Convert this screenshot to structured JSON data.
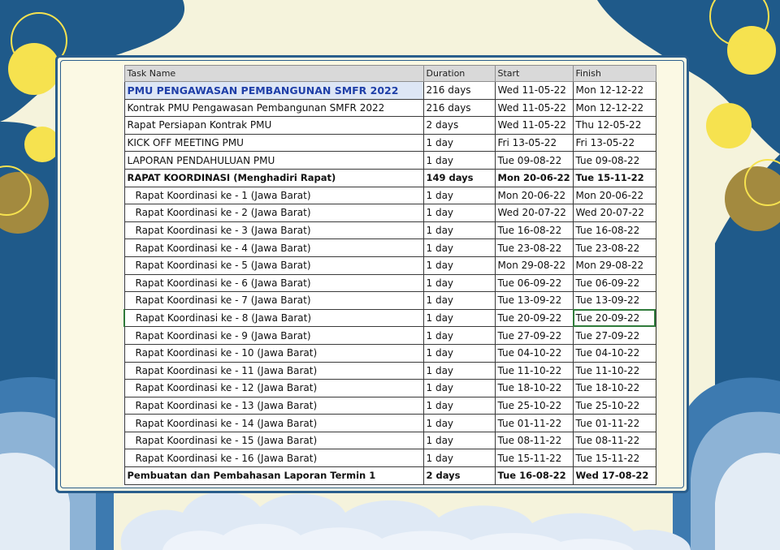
{
  "headers": {
    "task": "Task Name",
    "duration": "Duration",
    "start": "Start",
    "finish": "Finish"
  },
  "rows": [
    {
      "task": "PMU PENGAWASAN PEMBANGUNAN SMFR 2022",
      "duration": "216 days",
      "start": "Wed 11-05-22",
      "finish": "Mon 12-12-22"
    },
    {
      "task": "Kontrak PMU Pengawasan Pembangunan SMFR 2022",
      "duration": "216 days",
      "start": "Wed 11-05-22",
      "finish": "Mon 12-12-22"
    },
    {
      "task": "Rapat Persiapan Kontrak PMU",
      "duration": "2 days",
      "start": "Wed 11-05-22",
      "finish": "Thu 12-05-22"
    },
    {
      "task": "KICK OFF MEETING PMU",
      "duration": "1 day",
      "start": "Fri 13-05-22",
      "finish": "Fri 13-05-22"
    },
    {
      "task": "LAPORAN PENDAHULUAN PMU",
      "duration": "1 day",
      "start": "Tue 09-08-22",
      "finish": "Tue 09-08-22"
    },
    {
      "task": "RAPAT KOORDINASI (Menghadiri Rapat)",
      "duration": "149 days",
      "start": "Mon 20-06-22",
      "finish": "Tue 15-11-22"
    },
    {
      "task": "Rapat Koordinasi ke - 1 (Jawa Barat)",
      "duration": "1 day",
      "start": "Mon 20-06-22",
      "finish": "Mon 20-06-22"
    },
    {
      "task": "Rapat Koordinasi ke - 2 (Jawa Barat)",
      "duration": "1 day",
      "start": "Wed 20-07-22",
      "finish": "Wed 20-07-22"
    },
    {
      "task": "Rapat Koordinasi ke - 3 (Jawa Barat)",
      "duration": "1 day",
      "start": "Tue 16-08-22",
      "finish": "Tue 16-08-22"
    },
    {
      "task": "Rapat Koordinasi ke - 4 (Jawa Barat)",
      "duration": "1 day",
      "start": "Tue 23-08-22",
      "finish": "Tue 23-08-22"
    },
    {
      "task": "Rapat Koordinasi ke - 5 (Jawa Barat)",
      "duration": "1 day",
      "start": "Mon 29-08-22",
      "finish": "Mon 29-08-22"
    },
    {
      "task": "Rapat Koordinasi ke - 6 (Jawa Barat)",
      "duration": "1 day",
      "start": "Tue 06-09-22",
      "finish": "Tue 06-09-22"
    },
    {
      "task": "Rapat Koordinasi ke - 7 (Jawa Barat)",
      "duration": "1 day",
      "start": "Tue 13-09-22",
      "finish": "Tue 13-09-22"
    },
    {
      "task": "Rapat Koordinasi ke - 8 (Jawa Barat)",
      "duration": "1 day",
      "start": "Tue 20-09-22",
      "finish": "Tue 20-09-22"
    },
    {
      "task": "Rapat Koordinasi ke - 9 (Jawa Barat)",
      "duration": "1 day",
      "start": "Tue 27-09-22",
      "finish": "Tue 27-09-22"
    },
    {
      "task": "Rapat Koordinasi ke - 10 (Jawa Barat)",
      "duration": "1 day",
      "start": "Tue 04-10-22",
      "finish": "Tue 04-10-22"
    },
    {
      "task": "Rapat Koordinasi ke - 11 (Jawa Barat)",
      "duration": "1 day",
      "start": "Tue 11-10-22",
      "finish": "Tue 11-10-22"
    },
    {
      "task": "Rapat Koordinasi ke - 12 (Jawa Barat)",
      "duration": "1 day",
      "start": "Tue 18-10-22",
      "finish": "Tue 18-10-22"
    },
    {
      "task": "Rapat Koordinasi ke - 13 (Jawa Barat)",
      "duration": "1 day",
      "start": "Tue 25-10-22",
      "finish": "Tue 25-10-22"
    },
    {
      "task": "Rapat Koordinasi ke - 14 (Jawa Barat)",
      "duration": "1 day",
      "start": "Tue 01-11-22",
      "finish": "Tue 01-11-22"
    },
    {
      "task": "Rapat Koordinasi ke - 15 (Jawa Barat)",
      "duration": "1 day",
      "start": "Tue 08-11-22",
      "finish": "Tue 08-11-22"
    },
    {
      "task": "Rapat Koordinasi ke - 16 (Jawa Barat)",
      "duration": "1 day",
      "start": "Tue 15-11-22",
      "finish": "Tue 15-11-22"
    },
    {
      "task": "Pembuatan dan Pembahasan Laporan Termin 1",
      "duration": "2 days",
      "start": "Tue 16-08-22",
      "finish": "Wed 17-08-22"
    }
  ],
  "colors": {
    "frame": "#2a5e8c",
    "background": "#f5f3dc",
    "title_text": "#1f3fa8",
    "dark_blue": "#1f5a8a",
    "light_blue": "#8db3d6",
    "yellow": "#f6e24f",
    "olive": "#a38a3f",
    "selection": "#2f7a3a"
  }
}
